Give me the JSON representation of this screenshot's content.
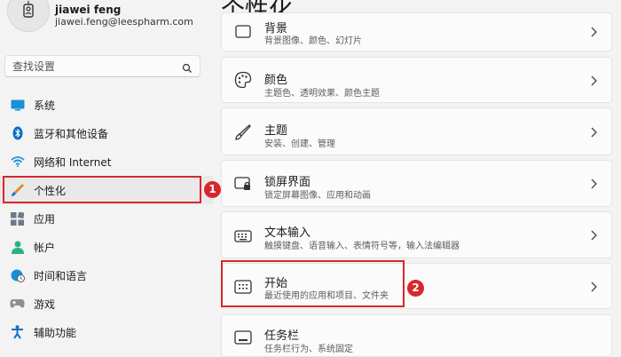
{
  "profile": {
    "name": "jiawei feng",
    "email": "jiawei.feng@leespharm.com"
  },
  "search": {
    "placeholder": "查找设置"
  },
  "nav": {
    "items": [
      {
        "label": "系统",
        "icon": "monitor-icon"
      },
      {
        "label": "蓝牙和其他设备",
        "icon": "bluetooth-icon"
      },
      {
        "label": "网络和 Internet",
        "icon": "wifi-icon"
      },
      {
        "label": "个性化",
        "icon": "brush-icon"
      },
      {
        "label": "应用",
        "icon": "apps-icon"
      },
      {
        "label": "帐户",
        "icon": "person-icon"
      },
      {
        "label": "时间和语言",
        "icon": "globe-clock-icon"
      },
      {
        "label": "游戏",
        "icon": "gamepad-icon"
      },
      {
        "label": "辅助功能",
        "icon": "accessibility-icon"
      }
    ]
  },
  "page": {
    "title": "个性化"
  },
  "cards": [
    {
      "title": "背景",
      "subtitle": "背景图像、颜色、幻灯片",
      "icon": "background-image-icon"
    },
    {
      "title": "颜色",
      "subtitle": "主题色、透明效果、颜色主题",
      "icon": "palette-icon"
    },
    {
      "title": "主题",
      "subtitle": "安装、创建、管理",
      "icon": "theme-brush-icon"
    },
    {
      "title": "锁屏界面",
      "subtitle": "锁定屏幕图像、应用和动画",
      "icon": "lock-screen-icon"
    },
    {
      "title": "文本输入",
      "subtitle": "触摸键盘、语音输入、表情符号等，输入法编辑器",
      "icon": "keyboard-icon"
    },
    {
      "title": "开始",
      "subtitle": "最近使用的应用和项目、文件夹",
      "icon": "start-menu-icon"
    },
    {
      "title": "任务栏",
      "subtitle": "任务栏行为、系统固定",
      "icon": "taskbar-icon"
    }
  ],
  "annotations": {
    "marker1": "1",
    "marker2": "2"
  },
  "colors": {
    "accent_red": "#d9262d",
    "background": "#f3f3f3",
    "card": "#fbfbfb"
  }
}
